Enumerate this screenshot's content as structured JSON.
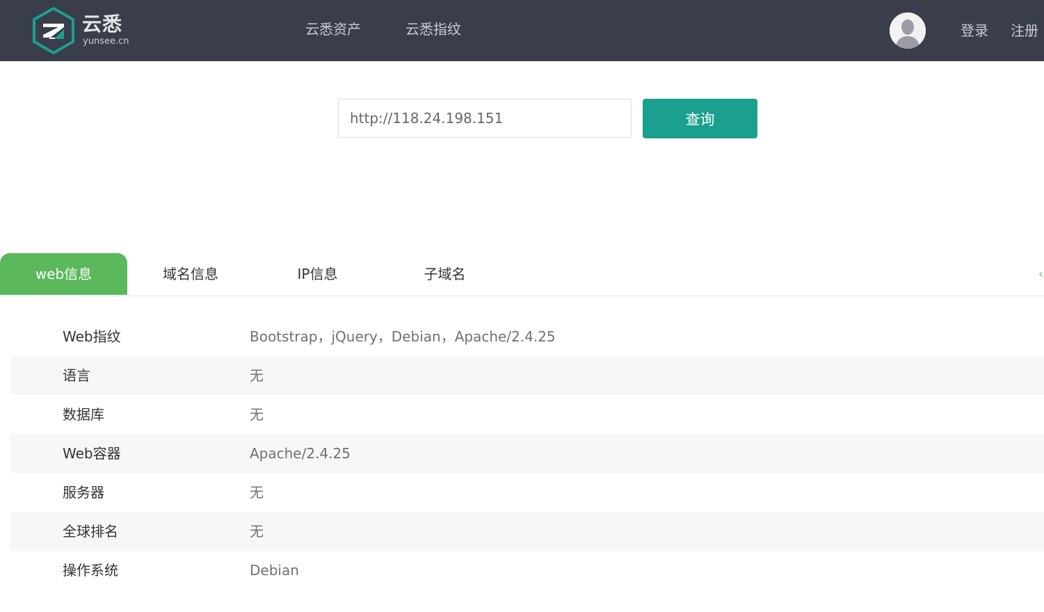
{
  "header": {
    "brand_cn": "云悉",
    "brand_en": "yunsee.cn",
    "nav": [
      {
        "label": "云悉资产"
      },
      {
        "label": "云悉指纹"
      }
    ],
    "login_label": "登录",
    "register_label": "注册"
  },
  "search": {
    "value": "http://118.24.198.151",
    "button_label": "查询"
  },
  "tabs": [
    {
      "label": "web信息",
      "active": true
    },
    {
      "label": "域名信息",
      "active": false
    },
    {
      "label": "IP信息",
      "active": false
    },
    {
      "label": "子域名",
      "active": false
    }
  ],
  "web_info": [
    {
      "key": "Web指纹",
      "value": "Bootstrap，jQuery，Debian，Apache/2.4.25"
    },
    {
      "key": "语言",
      "value": "无"
    },
    {
      "key": "数据库",
      "value": "无"
    },
    {
      "key": "Web容器",
      "value": "Apache/2.4.25"
    },
    {
      "key": "服务器",
      "value": "无"
    },
    {
      "key": "全球排名",
      "value": "无"
    },
    {
      "key": "操作系统",
      "value": "Debian"
    }
  ],
  "colors": {
    "topbar": "#3a3d4a",
    "accent_teal": "#1ba090",
    "tab_active": "#5cb85c"
  }
}
